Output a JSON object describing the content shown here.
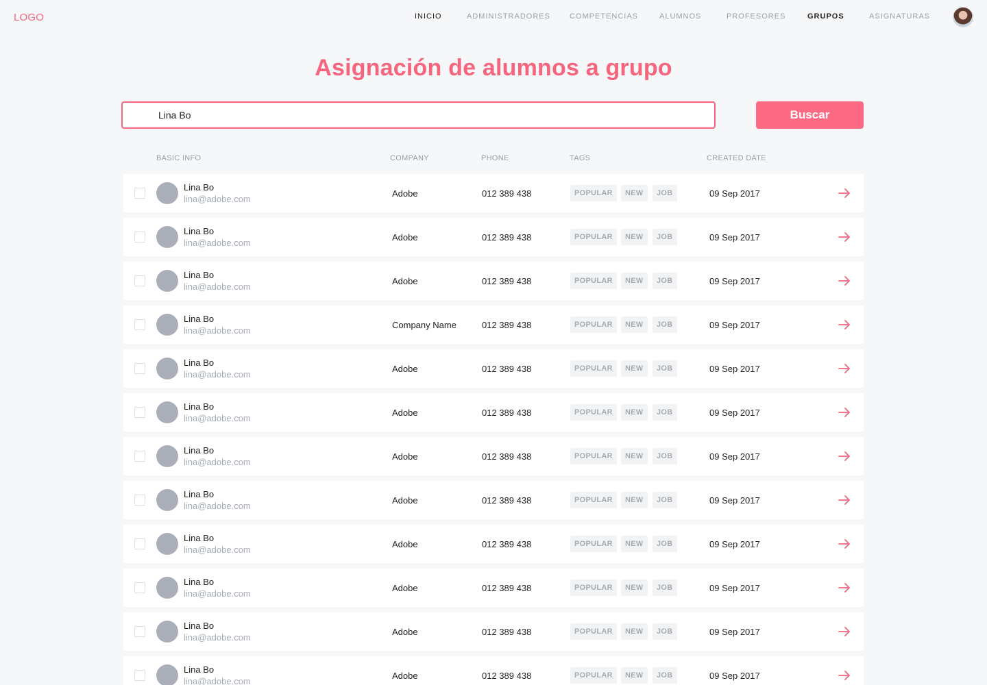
{
  "header": {
    "logo": "LOGO",
    "nav": [
      {
        "label": "INICIO"
      },
      {
        "label": "ADMINISTRADORES"
      },
      {
        "label": "COMPETENCIAS"
      },
      {
        "label": "ALUMNOS"
      },
      {
        "label": "PROFESORES"
      },
      {
        "label": "GRUPOS"
      },
      {
        "label": "ASIGNATURAS"
      }
    ]
  },
  "page": {
    "title": "Asignación de alumnos a grupo"
  },
  "search": {
    "value": "Lina Bo",
    "button_label": "Buscar"
  },
  "colors": {
    "accent": "#f5657d",
    "button": "#fd6a83",
    "avatar_placeholder": "#a9aeb8"
  },
  "table": {
    "columns": {
      "basic_info": "BASIC INFO",
      "company": "COMPANY",
      "phone": "PHONE",
      "tags": "TAGS",
      "created_date": "CREATED DATE"
    },
    "rows": [
      {
        "name": "Lina Bo",
        "email": "lina@adobe.com",
        "company": "Adobe",
        "phone": "012 389 438",
        "tags": [
          "POPULAR",
          "NEW",
          "JOB"
        ],
        "date": "09 Sep 2017"
      },
      {
        "name": "Lina Bo",
        "email": "lina@adobe.com",
        "company": "Adobe",
        "phone": "012 389 438",
        "tags": [
          "POPULAR",
          "NEW",
          "JOB"
        ],
        "date": "09 Sep 2017"
      },
      {
        "name": "Lina Bo",
        "email": "lina@adobe.com",
        "company": "Adobe",
        "phone": "012 389 438",
        "tags": [
          "POPULAR",
          "NEW",
          "JOB"
        ],
        "date": "09 Sep 2017"
      },
      {
        "name": "Lina Bo",
        "email": "lina@adobe.com",
        "company": "Company Name",
        "phone": "012 389 438",
        "tags": [
          "POPULAR",
          "NEW",
          "JOB"
        ],
        "date": "09 Sep 2017"
      },
      {
        "name": "Lina Bo",
        "email": "lina@adobe.com",
        "company": "Adobe",
        "phone": "012 389 438",
        "tags": [
          "POPULAR",
          "NEW",
          "JOB"
        ],
        "date": "09 Sep 2017"
      },
      {
        "name": "Lina Bo",
        "email": "lina@adobe.com",
        "company": "Adobe",
        "phone": "012 389 438",
        "tags": [
          "POPULAR",
          "NEW",
          "JOB"
        ],
        "date": "09 Sep 2017"
      },
      {
        "name": "Lina Bo",
        "email": "lina@adobe.com",
        "company": "Adobe",
        "phone": "012 389 438",
        "tags": [
          "POPULAR",
          "NEW",
          "JOB"
        ],
        "date": "09 Sep 2017"
      },
      {
        "name": "Lina Bo",
        "email": "lina@adobe.com",
        "company": "Adobe",
        "phone": "012 389 438",
        "tags": [
          "POPULAR",
          "NEW",
          "JOB"
        ],
        "date": "09 Sep 2017"
      },
      {
        "name": "Lina Bo",
        "email": "lina@adobe.com",
        "company": "Adobe",
        "phone": "012 389 438",
        "tags": [
          "POPULAR",
          "NEW",
          "JOB"
        ],
        "date": "09 Sep 2017"
      },
      {
        "name": "Lina Bo",
        "email": "lina@adobe.com",
        "company": "Adobe",
        "phone": "012 389 438",
        "tags": [
          "POPULAR",
          "NEW",
          "JOB"
        ],
        "date": "09 Sep 2017"
      },
      {
        "name": "Lina Bo",
        "email": "lina@adobe.com",
        "company": "Adobe",
        "phone": "012 389 438",
        "tags": [
          "POPULAR",
          "NEW",
          "JOB"
        ],
        "date": "09 Sep 2017"
      },
      {
        "name": "Lina Bo",
        "email": "lina@adobe.com",
        "company": "Adobe",
        "phone": "012 389 438",
        "tags": [
          "POPULAR",
          "NEW",
          "JOB"
        ],
        "date": "09 Sep 2017"
      }
    ]
  }
}
